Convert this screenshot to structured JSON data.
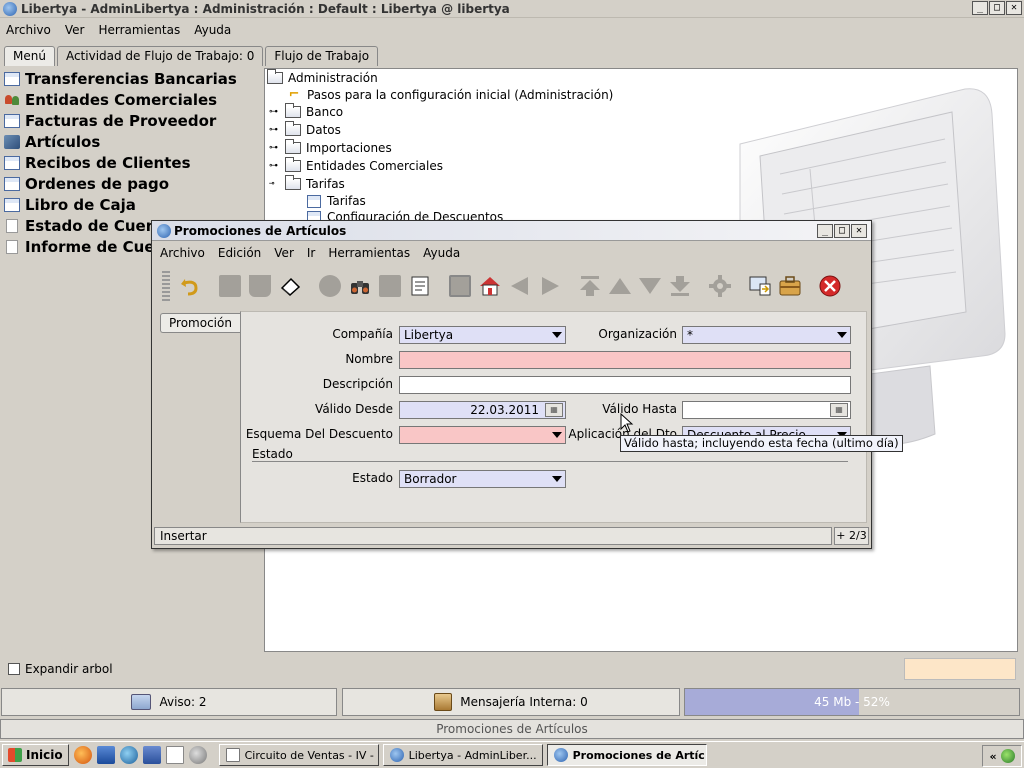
{
  "main_window": {
    "title": "Libertya   -   AdminLibertya : Administración : Default : Libertya @ libertya",
    "menu": [
      "Archivo",
      "Ver",
      "Herramientas",
      "Ayuda"
    ],
    "tabs": [
      "Menú",
      "Actividad de Flujo de Trabajo: 0",
      "Flujo de Trabajo"
    ],
    "win_buttons": [
      "_",
      "□",
      "✕"
    ]
  },
  "left_menu": [
    {
      "label": "Transferencias Bancarias",
      "icon": "window-icon"
    },
    {
      "label": "Entidades Comerciales",
      "icon": "people-icon"
    },
    {
      "label": "Facturas de Proveedor",
      "icon": "window-icon"
    },
    {
      "label": "Artículos",
      "icon": "box-icon"
    },
    {
      "label": "Recibos de Clientes",
      "icon": "window-icon"
    },
    {
      "label": "Ordenes de pago",
      "icon": "window-icon"
    },
    {
      "label": "Libro de Caja",
      "icon": "window-icon"
    },
    {
      "label": "Estado de Cuent",
      "icon": "document-icon"
    },
    {
      "label": "Informe de Cuen",
      "icon": "document-icon"
    }
  ],
  "tree": {
    "root": "Administración",
    "items": [
      {
        "label": "Pasos para la configuración inicial (Administración)",
        "type": "workflow"
      },
      {
        "label": "Banco",
        "type": "folder",
        "expander": "⊶"
      },
      {
        "label": "Datos",
        "type": "folder",
        "expander": "⊶"
      },
      {
        "label": "Importaciones",
        "type": "folder",
        "expander": "⊶"
      },
      {
        "label": "Entidades Comerciales",
        "type": "folder",
        "expander": "⊶"
      },
      {
        "label": "Tarifas",
        "type": "folder",
        "expander": "⊸"
      }
    ],
    "sub_items": [
      "Tarifas",
      "Configuración de Descuentos"
    ]
  },
  "footer": {
    "expand_label": "Expandir arbol",
    "aviso": "Aviso: 2",
    "mensajeria": "Mensajería Interna: 0",
    "memory_label": "45 Mb - 52%",
    "memory_fraction": 0.52,
    "window_caption": "Promociones de Artículos"
  },
  "taskbar": {
    "start": "Inicio",
    "tasks": [
      "Circuito de Ventas - IV - ...",
      "Libertya   -   AdminLiber...",
      "Promociones de Artíc..."
    ],
    "tray_text": "«"
  },
  "dialog": {
    "title": "Promociones de Artículos",
    "menu": [
      "Archivo",
      "Edición",
      "Ver",
      "Ir",
      "Herramientas",
      "Ayuda"
    ],
    "side_tab": "Promoción",
    "fields": {
      "compania_label": "Compañía",
      "compania_value": "Libertya",
      "organizacion_label": "Organización",
      "organizacion_value": "*",
      "nombre_label": "Nombre",
      "nombre_value": "",
      "descripcion_label": "Descripción",
      "descripcion_value": "",
      "valido_desde_label": "Válido Desde",
      "valido_desde_value": "22.03.2011",
      "valido_hasta_label": "Válido Hasta",
      "valido_hasta_value": "",
      "esquema_label": "Esquema Del Descuento",
      "esquema_value": "",
      "aplicacion_label": "Aplicación del Dto",
      "aplicacion_value": "Descuento al Precio",
      "estado_section": "Estado",
      "estado_label": "Estado",
      "estado_value": "Borrador"
    },
    "tooltip": "Válido hasta; incluyendo esta fecha (ultimo día)",
    "status": "Insertar",
    "counter": "+ 2/3"
  },
  "colors": {
    "mandatory_field": "#f9c6c6",
    "readonly_field": "#dfe0f6",
    "memory_bar": "#a7abd8",
    "delete_button": "#d42a2a"
  }
}
